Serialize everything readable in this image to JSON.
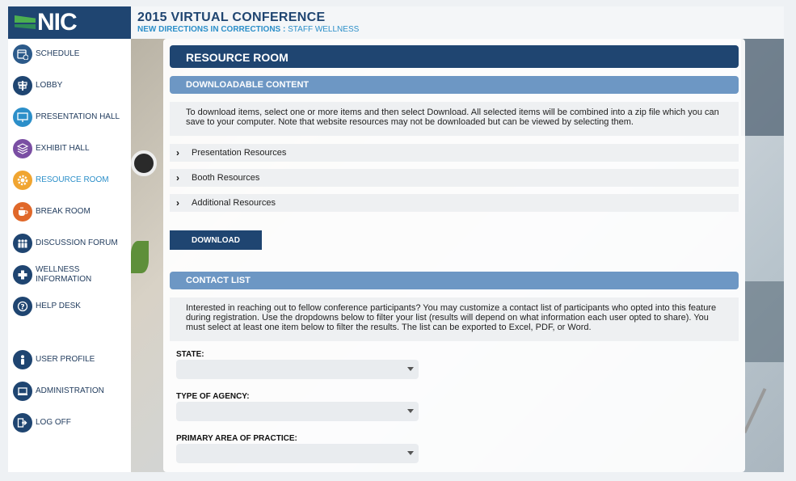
{
  "brand": "NIC",
  "header": {
    "title": "2015 VIRTUAL CONFERENCE",
    "subtitle_prefix": "NEW DIRECTIONS IN CORRECTIONS : ",
    "subtitle_rest": "STAFF WELLNESS"
  },
  "nav": {
    "schedule": "SCHEDULE",
    "lobby": "LOBBY",
    "presentation_hall": "PRESENTATION HALL",
    "exhibit_hall": "EXHIBIT HALL",
    "resource_room": "RESOURCE ROOM",
    "break_room": "BREAK ROOM",
    "discussion_forum": "DISCUSSION FORUM",
    "wellness_line1": "WELLNESS",
    "wellness_line2": "INFORMATION",
    "help_desk": "HELP DESK",
    "user_profile": "USER PROFILE",
    "administration": "ADMINISTRATION",
    "log_off": "LOG OFF"
  },
  "page": {
    "title": "RESOURCE ROOM",
    "downloadable": {
      "heading": "DOWNLOADABLE CONTENT",
      "info": "To download items, select one or more items and then select Download. All selected items will be combined into a zip file which you can save to your computer. Note that website resources may not be downloaded but can be viewed by selecting them.",
      "sections": [
        "Presentation Resources",
        "Booth Resources",
        "Additional Resources"
      ],
      "download_label": "DOWNLOAD"
    },
    "contact": {
      "heading": "CONTACT LIST",
      "info": "Interested in reaching out to fellow conference participants? You may customize a contact list of participants who opted into this feature during registration. Use the dropdowns below to filter your list (results will depend on what information each user opted to share). You must select at least one item below to filter the results. The list can be exported to Excel, PDF, or Word.",
      "state_label": "STATE:",
      "agency_label": "TYPE OF AGENCY:",
      "practice_label": "PRIMARY AREA OF PRACTICE:"
    }
  },
  "colors": {
    "navy": "#1f4571",
    "accent_blue": "#2c8fc9",
    "section_blue": "#6d97c4",
    "active_orange": "#f0a531"
  },
  "icons": {
    "schedule": "calendar-clock-icon",
    "lobby": "signpost-icon",
    "presentation_hall": "monitor-icon",
    "exhibit_hall": "layers-icon",
    "resource_room": "gear-icon",
    "break_room": "coffee-cup-icon",
    "discussion_forum": "people-icon",
    "wellness": "plus-icon",
    "help_desk": "question-icon",
    "user_profile": "user-icon",
    "administration": "laptop-icon",
    "log_off": "logout-icon"
  }
}
